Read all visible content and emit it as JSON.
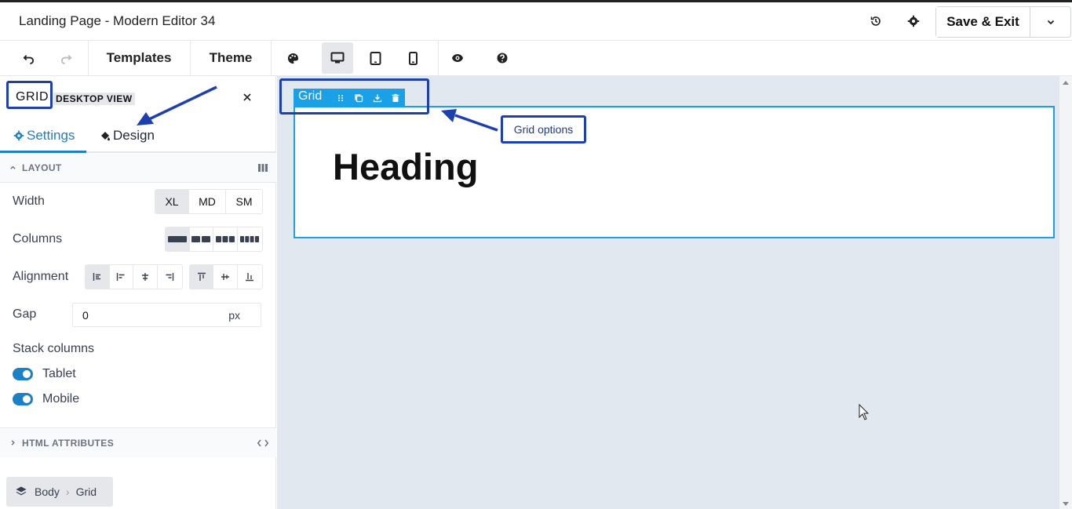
{
  "window": {
    "title": "Landing Page - Modern Editor 34",
    "save_label": "Save & Exit"
  },
  "toolbar": {
    "templates_label": "Templates",
    "theme_label": "Theme"
  },
  "panel": {
    "element_type": "GRID",
    "view_badge": "DESKTOP VIEW",
    "tabs": [
      {
        "label": "Settings",
        "icon": "gear-icon"
      },
      {
        "label": "Design",
        "icon": "paint-bucket-icon"
      }
    ],
    "layout_section": "LAYOUT",
    "width": {
      "label": "Width",
      "options": [
        "XL",
        "MD",
        "SM"
      ],
      "selected": "XL"
    },
    "columns": {
      "label": "Columns"
    },
    "alignment": {
      "label": "Alignment"
    },
    "gap": {
      "label": "Gap",
      "value": "0",
      "unit": "px"
    },
    "stack": {
      "label": "Stack columns",
      "tablet_label": "Tablet",
      "mobile_label": "Mobile"
    },
    "html_section": "HTML ATTRIBUTES",
    "breadcrumb": [
      "Body",
      "Grid"
    ]
  },
  "canvas": {
    "grid_label": "Grid",
    "heading": "Heading"
  },
  "annotation": {
    "label": "Grid options"
  },
  "colors": {
    "accent": "#1d7fc4",
    "selection": "#1aa0e6",
    "annotation": "#1e40af",
    "canvas_bg": "#e2e8f0"
  }
}
